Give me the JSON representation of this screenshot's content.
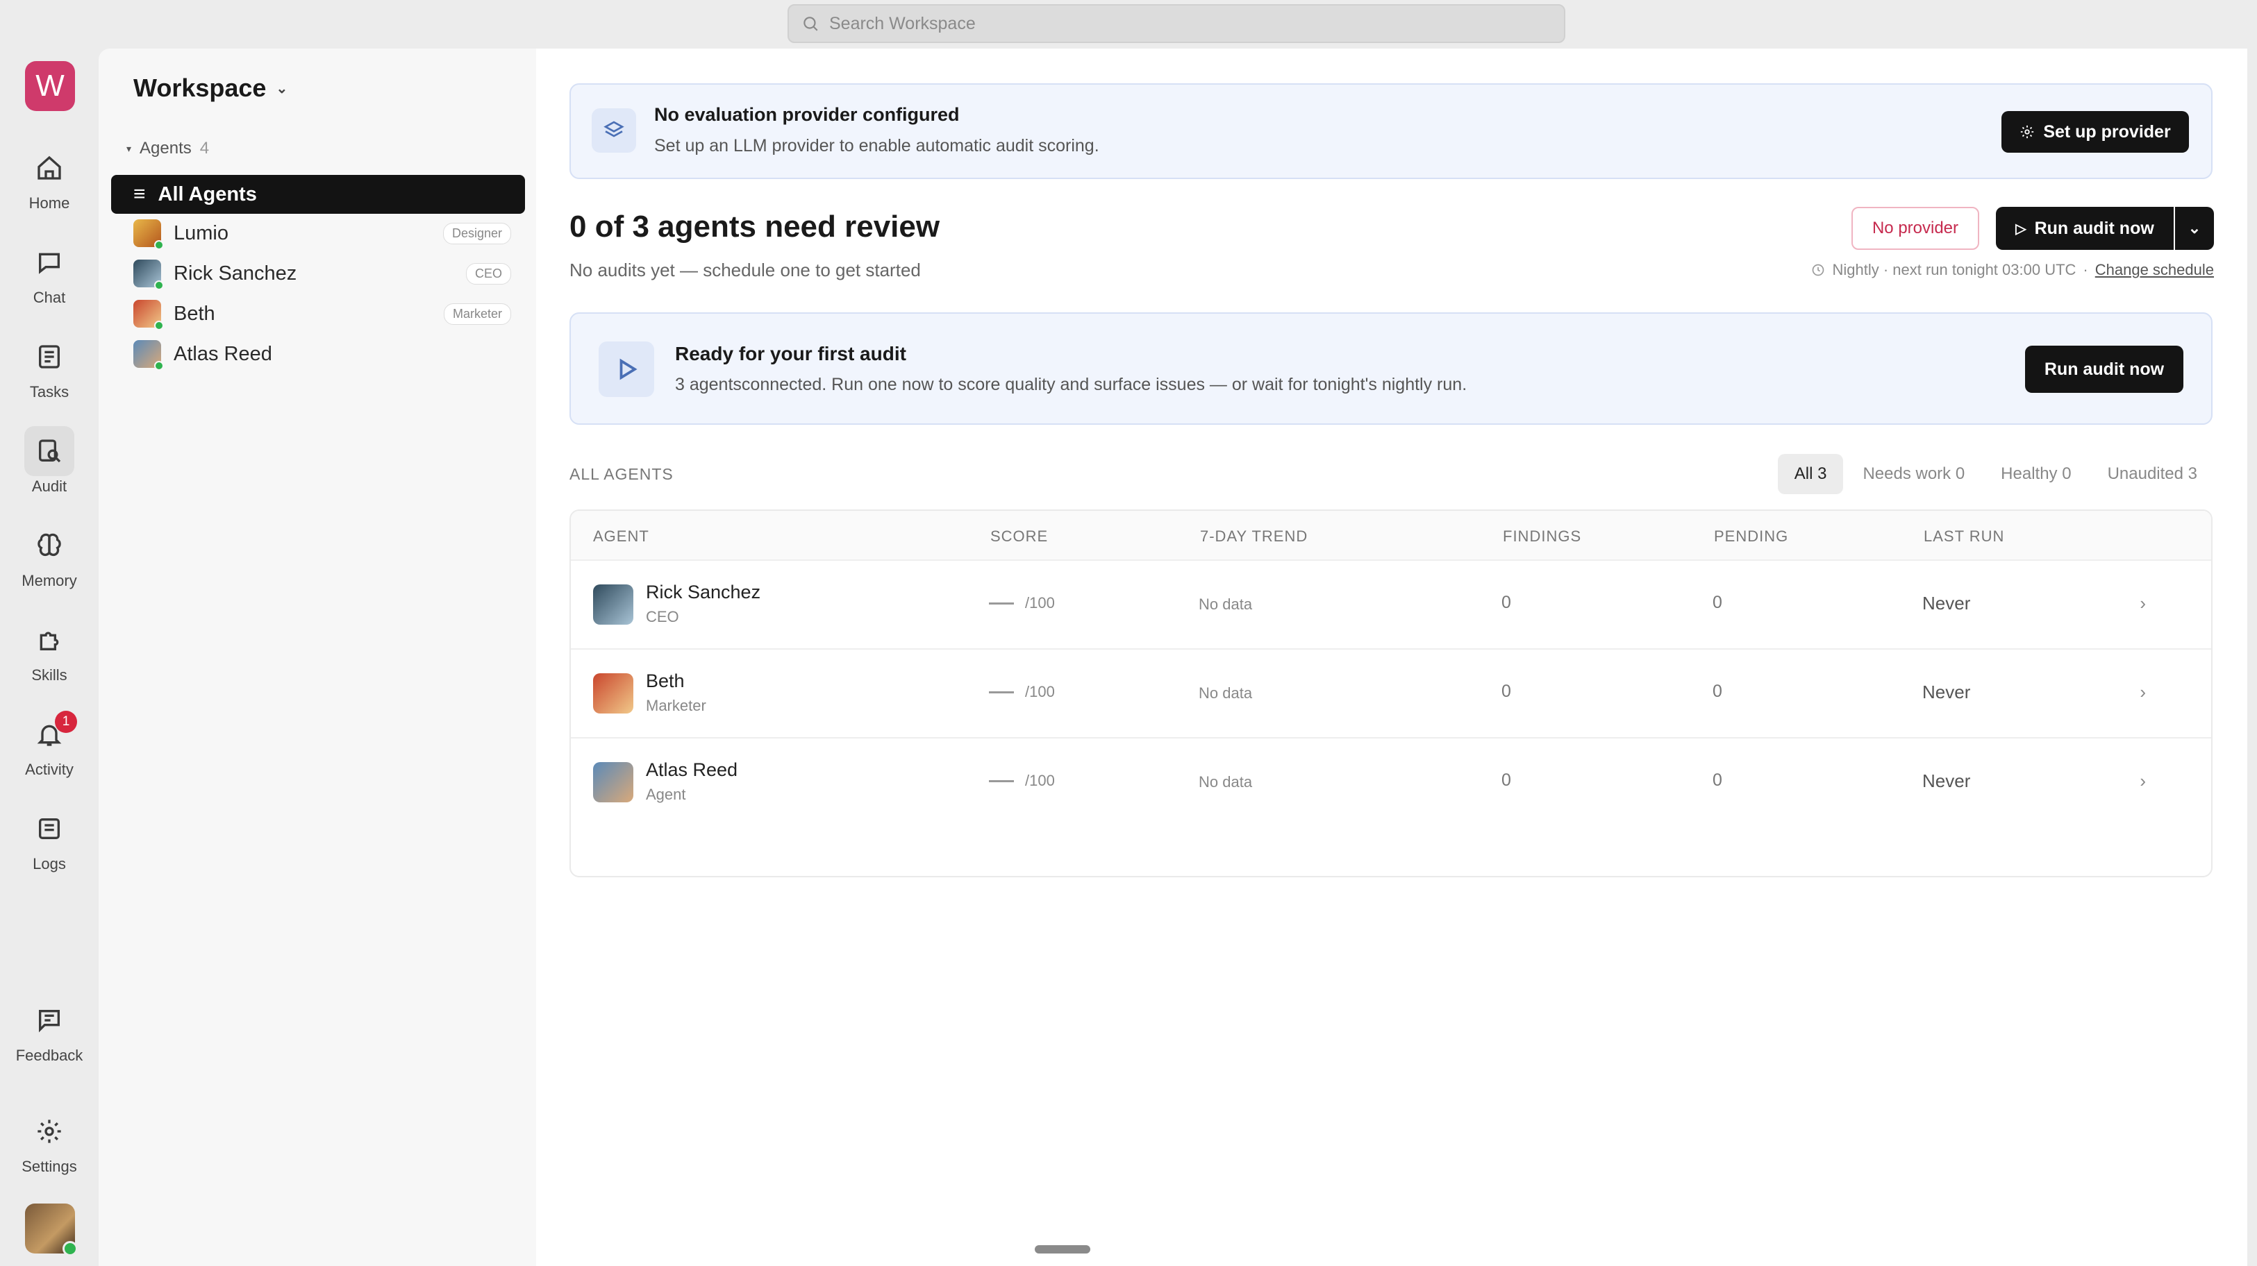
{
  "search": {
    "placeholder": "Search Workspace"
  },
  "rail": {
    "logo_letter": "W",
    "items": [
      {
        "label": "Home",
        "icon": "home-icon"
      },
      {
        "label": "Chat",
        "icon": "chat-icon"
      },
      {
        "label": "Tasks",
        "icon": "tasks-icon"
      },
      {
        "label": "Audit",
        "icon": "audit-icon"
      },
      {
        "label": "Memory",
        "icon": "brain-icon"
      },
      {
        "label": "Skills",
        "icon": "puzzle-icon"
      },
      {
        "label": "Activity",
        "icon": "bell-icon",
        "badge": "1"
      },
      {
        "label": "Logs",
        "icon": "logs-icon"
      },
      {
        "label": "Feedback",
        "icon": "feedback-icon"
      },
      {
        "label": "Settings",
        "icon": "gear-icon"
      }
    ]
  },
  "sidebar": {
    "title": "Workspace",
    "group_label": "Agents",
    "group_count": "4",
    "items": [
      {
        "label": "All Agents",
        "tag": ""
      },
      {
        "label": "Lumio",
        "tag": "Designer"
      },
      {
        "label": "Rick Sanchez",
        "tag": "CEO"
      },
      {
        "label": "Beth",
        "tag": "Marketer"
      },
      {
        "label": "Atlas Reed",
        "tag": ""
      }
    ]
  },
  "banner": {
    "title": "No evaluation provider configured",
    "subtitle": "Set up an LLM provider to enable automatic audit scoring.",
    "button": "Set up provider"
  },
  "summary": {
    "headline": "0 of 3 agents need review",
    "subline": "No audits yet — schedule one to get started",
    "no_provider": "No provider",
    "run_button": "Run audit now",
    "schedule_text": "Nightly · next run tonight 03:00 UTC",
    "separator": "·",
    "change_schedule": "Change schedule"
  },
  "ready": {
    "title": "Ready for your first audit",
    "subtitle": "3 agentsconnected. Run one now to score quality and surface issues — or wait for tonight's nightly run.",
    "button": "Run audit now"
  },
  "agents_section": {
    "label": "ALL AGENTS",
    "filters": [
      "All 3",
      "Needs work 0",
      "Healthy 0",
      "Unaudited 3"
    ]
  },
  "table": {
    "headers": [
      "AGENT",
      "SCORE",
      "7-DAY TREND",
      "FINDINGS",
      "PENDING",
      "LAST RUN"
    ],
    "rows": [
      {
        "name": "Rick Sanchez",
        "role": "CEO",
        "score": "/100",
        "trend": "No data",
        "findings": "0",
        "pending": "0",
        "last_run": "Never"
      },
      {
        "name": "Beth",
        "role": "Marketer",
        "score": "/100",
        "trend": "No data",
        "findings": "0",
        "pending": "0",
        "last_run": "Never"
      },
      {
        "name": "Atlas Reed",
        "role": "Agent",
        "score": "/100",
        "trend": "No data",
        "findings": "0",
        "pending": "0",
        "last_run": "Never"
      }
    ]
  },
  "colors": {
    "brand": "#cf3a6b",
    "dark_button": "#141414",
    "banner_bg": "#f1f5fd",
    "warning_text": "#c62a4e",
    "online": "#2fb34f"
  }
}
